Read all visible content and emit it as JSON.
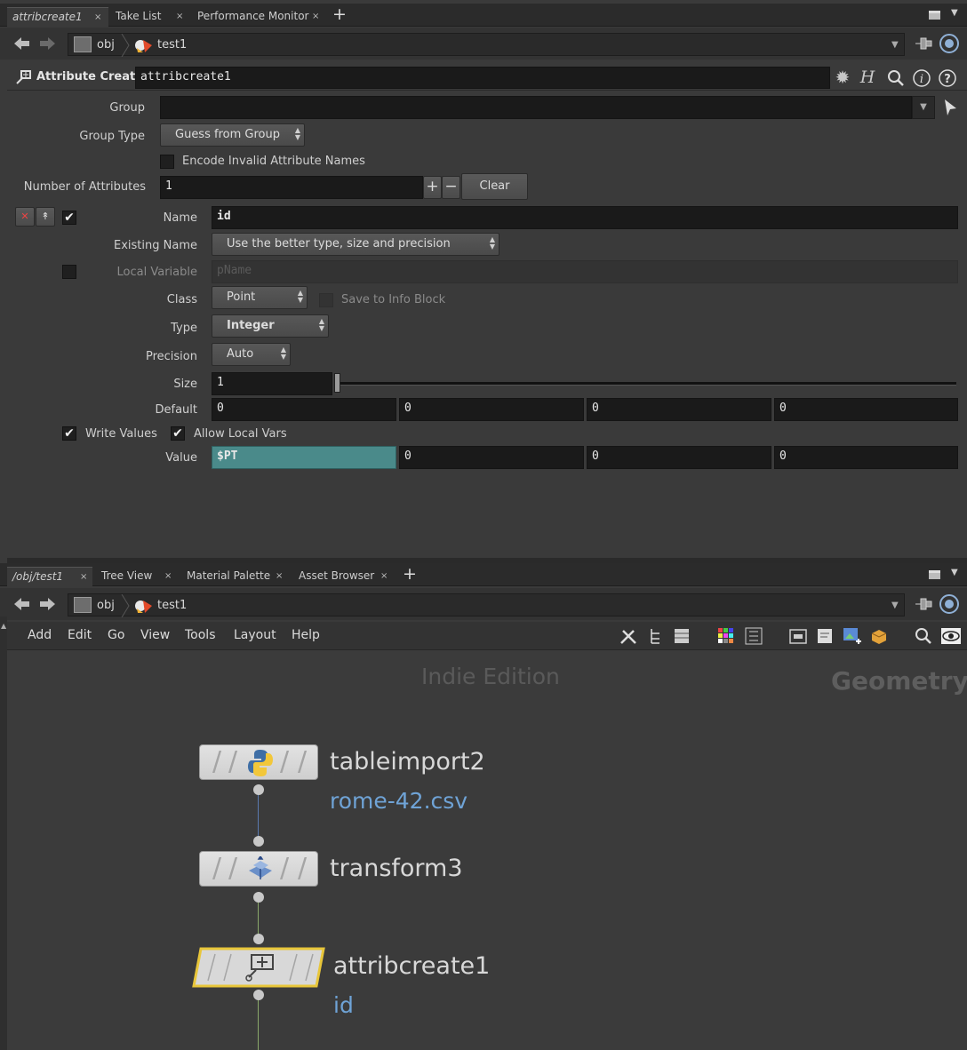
{
  "top_tabs": [
    {
      "label": "attribcreate1",
      "active": true
    },
    {
      "label": "Take List",
      "active": false
    },
    {
      "label": "Performance Monitor",
      "active": false
    }
  ],
  "add_tab_icon": "+",
  "close_icon": "×",
  "path_top": {
    "root": "obj",
    "node": "test1"
  },
  "param_header": {
    "type": "Attribute Create",
    "name": "attribcreate1"
  },
  "params": {
    "group_label": "Group",
    "group_value": "",
    "group_type_label": "Group Type",
    "group_type_value": "Guess from Group",
    "encode_label": "Encode Invalid Attribute Names",
    "num_attr_label": "Number of Attributes",
    "num_attr_value": "1",
    "plus": "+",
    "minus": "−",
    "clear_label": "Clear",
    "name_label": "Name",
    "name_value": "id",
    "existing_label": "Existing Name",
    "existing_value": "Use the better type, size and precision",
    "local_var_label": "Local Variable",
    "local_var_placeholder": "pName",
    "class_label": "Class",
    "class_value": "Point",
    "save_info_label": "Save to Info Block",
    "type_label": "Type",
    "type_value": "Integer",
    "precision_label": "Precision",
    "precision_value": "Auto",
    "size_label": "Size",
    "size_value": "1",
    "size_slider_fraction": 0.0,
    "default_label": "Default",
    "default_values": [
      "0",
      "0",
      "0",
      "0"
    ],
    "write_values_label": "Write Values",
    "allow_local_label": "Allow Local Vars",
    "value_label": "Value",
    "value_values": [
      "$PT",
      "0",
      "0",
      "0"
    ]
  },
  "bottom_tabs": [
    {
      "label": "/obj/test1",
      "active": true
    },
    {
      "label": "Tree View",
      "active": false
    },
    {
      "label": "Material Palette",
      "active": false
    },
    {
      "label": "Asset Browser",
      "active": false
    }
  ],
  "path_bottom": {
    "root": "obj",
    "node": "test1"
  },
  "network_menu": [
    "Add",
    "Edit",
    "Go",
    "View",
    "Tools",
    "Layout",
    "Help"
  ],
  "watermark": "Indie Edition",
  "context_label": "Geometry",
  "nodes": [
    {
      "name": "tableimport2",
      "sub": "rome-42.csv",
      "icon": "python-icon",
      "selected": false
    },
    {
      "name": "transform3",
      "sub": "",
      "icon": "transform-icon",
      "selected": false
    },
    {
      "name": "attribcreate1",
      "sub": "id",
      "icon": "attribcreate-icon",
      "selected": true
    }
  ],
  "colors": {
    "accent_value": "#4a8a8a",
    "selected_node": "#e8c63a",
    "node_sub": "#6fa3d6"
  }
}
